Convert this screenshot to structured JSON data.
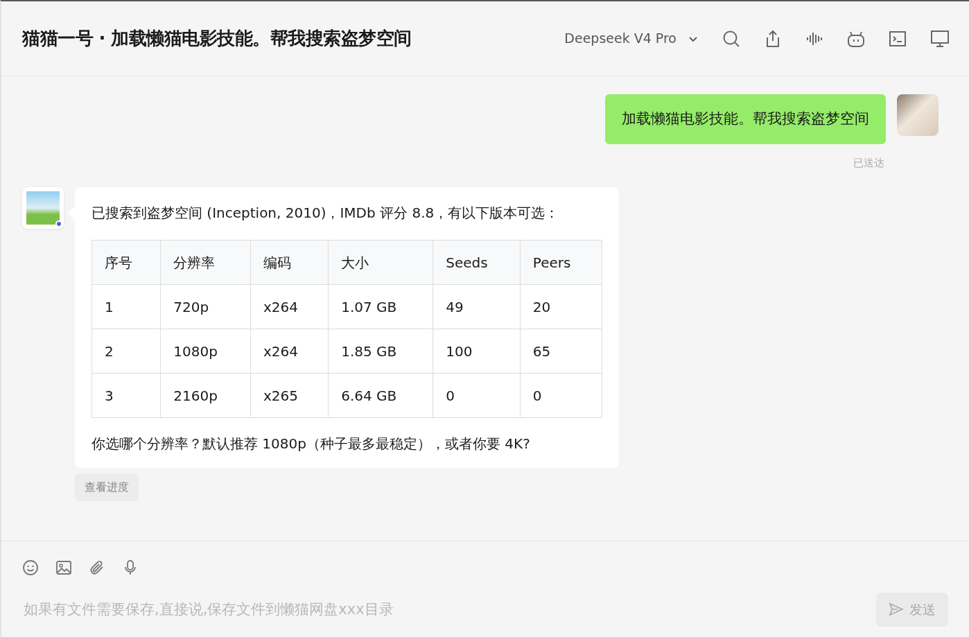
{
  "header": {
    "title": "猫猫一号 · 加载懒猫电影技能。帮我搜索盗梦空间",
    "model": "Deepseek V4 Pro"
  },
  "messages": [
    {
      "kind": "user",
      "text": "加载懒猫电影技能。帮我搜索盗梦空间",
      "status": "已送达"
    },
    {
      "kind": "bot",
      "online": true,
      "intro": "已搜索到盗梦空间 (Inception, 2010)，IMDb 评分 8.8，有以下版本可选：",
      "table": {
        "columns": [
          "序号",
          "分辨率",
          "编码",
          "大小",
          "Seeds",
          "Peers"
        ],
        "rows": [
          [
            "1",
            "720p",
            "x264",
            "1.07 GB",
            "49",
            "20"
          ],
          [
            "2",
            "1080p",
            "x264",
            "1.85 GB",
            "100",
            "65"
          ],
          [
            "3",
            "2160p",
            "x265",
            "6.64 GB",
            "0",
            "0"
          ]
        ]
      },
      "outro": "你选哪个分辨率？默认推荐 1080p（种子最多最稳定），或者你要 4K?",
      "action": "查看进度"
    }
  ],
  "composer": {
    "placeholder": "如果有文件需要保存,直接说,保存文件到懒猫网盘xxx目录",
    "send": "发送",
    "send_disabled": true
  }
}
